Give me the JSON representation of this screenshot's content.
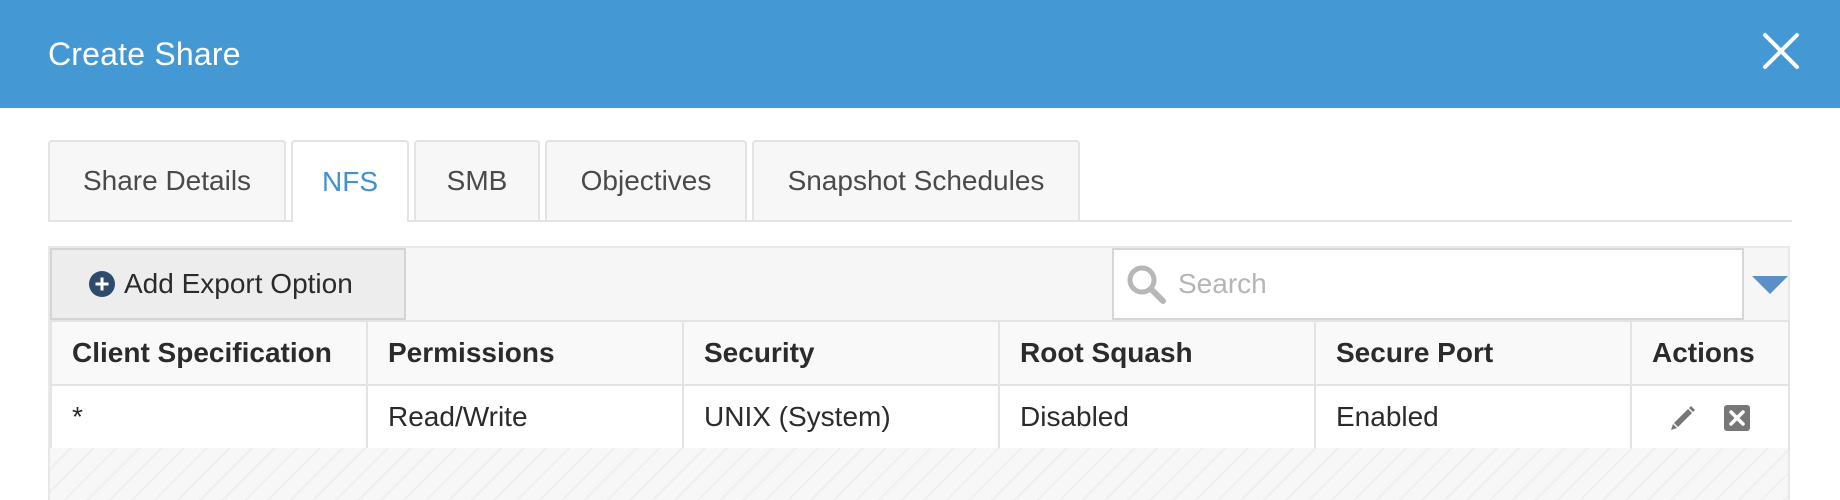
{
  "dialog": {
    "title": "Create Share",
    "close_icon": "close-icon",
    "header_color": "#4499d5"
  },
  "tabs": [
    {
      "label": "Share Details",
      "active": false
    },
    {
      "label": "NFS",
      "active": true
    },
    {
      "label": "SMB",
      "active": false
    },
    {
      "label": "Objectives",
      "active": false
    },
    {
      "label": "Snapshot Schedules",
      "active": false
    }
  ],
  "toolbar": {
    "add_label": "Add Export Option",
    "add_icon": "plus-circle-icon",
    "search_placeholder": "Search",
    "search_icon": "search-icon",
    "filter_icon": "triangle-down-icon"
  },
  "table": {
    "columns": [
      "Client Specification",
      "Permissions",
      "Security",
      "Root Squash",
      "Secure Port",
      "Actions"
    ],
    "rows": [
      {
        "client": "*",
        "permissions": "Read/Write",
        "security": "UNIX (System)",
        "root_squash": "Disabled",
        "secure_port": "Enabled",
        "actions": [
          "edit-icon",
          "delete-icon"
        ]
      }
    ]
  },
  "colors": {
    "accent": "#3f92d2",
    "icon_gray": "#777777"
  }
}
